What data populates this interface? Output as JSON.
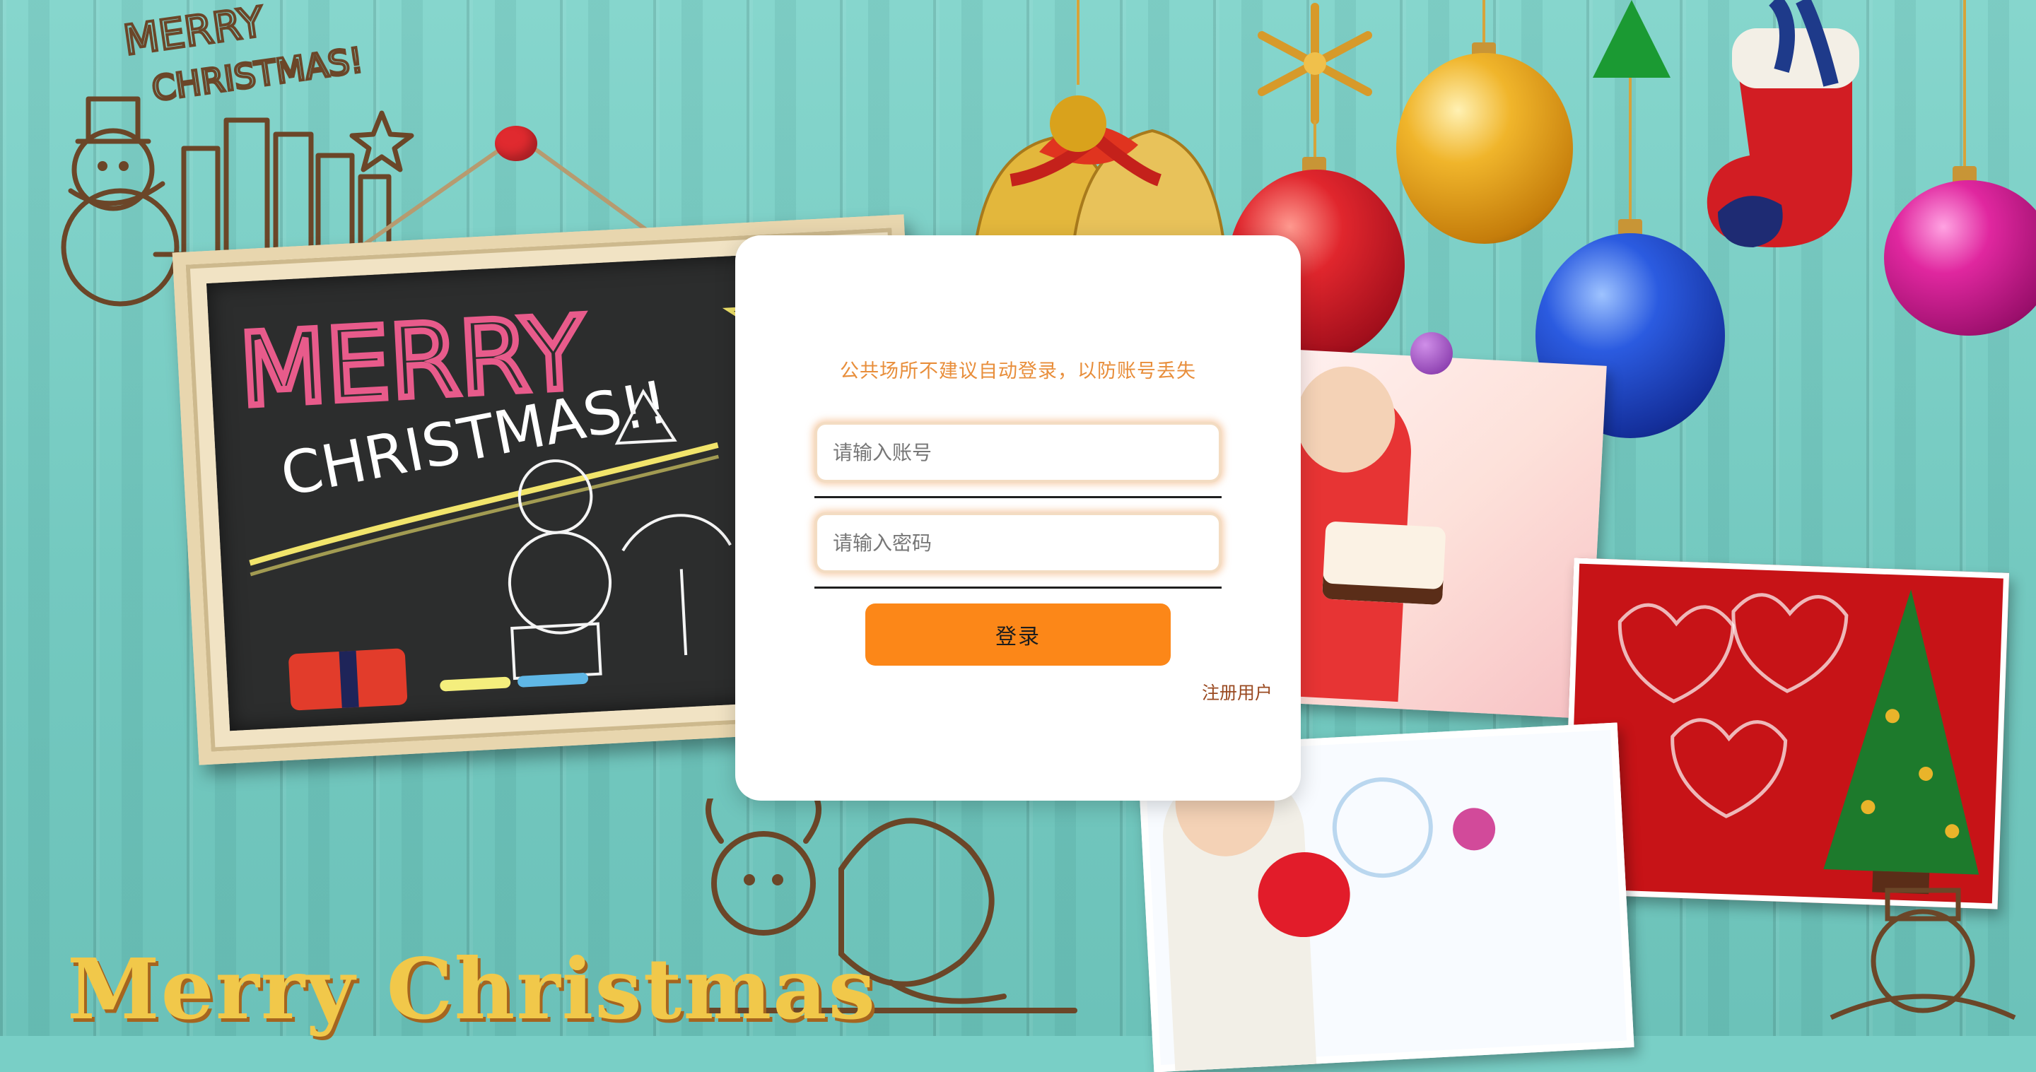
{
  "background": {
    "wall_color": "#79cfc6",
    "chalkboard_text": [
      "MERRY",
      "CHRISTMAS!!"
    ],
    "corner_doodle_text": [
      "MERRY",
      "CHRISTMAS!"
    ],
    "bottom_banner_text": "Merry Christmas",
    "ornament_colors": [
      "#d9a21c",
      "#c41d25",
      "#1f44b8",
      "#cc1f8a"
    ]
  },
  "login": {
    "notice": "公共场所不建议自动登录，以防账号丢失",
    "account_placeholder": "请输入账号",
    "password_placeholder": "请输入密码",
    "login_label": "登录",
    "register_label": "注册用户"
  },
  "theme": {
    "accent": "#fc8718",
    "notice_color": "#e88e3b",
    "link_color": "#9a4a21"
  }
}
